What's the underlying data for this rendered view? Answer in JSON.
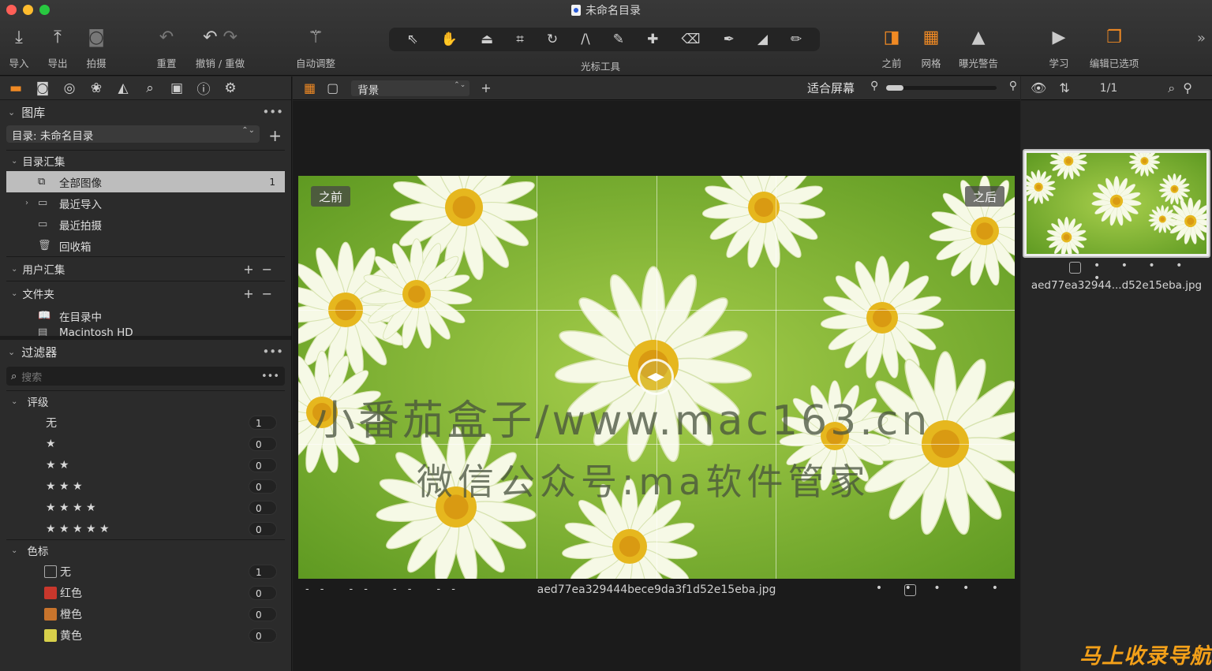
{
  "window": {
    "title": "未命名目录"
  },
  "toolbar": {
    "import": "导入",
    "export": "导出",
    "capture": "拍摄",
    "reset": "重置",
    "undo_redo": "撤销 / 重做",
    "auto_adjust": "自动调整",
    "cursor_tools": "光标工具",
    "before": "之前",
    "grid": "网格",
    "exposure_warning": "曝光警告",
    "learn": "学习",
    "edit_selected": "编辑已选项"
  },
  "library": {
    "title": "图库",
    "catalog_select": "目录: 未命名目录",
    "catalog_collections": "目录汇集",
    "items": [
      {
        "label": "全部图像",
        "count": "1"
      },
      {
        "label": "最近导入"
      },
      {
        "label": "最近拍摄"
      },
      {
        "label": "回收箱"
      }
    ],
    "user_collections": "用户汇集",
    "folders": "文件夹",
    "in_catalog": "在目录中",
    "macintosh": "Macintosh HD"
  },
  "filters": {
    "title": "过滤器",
    "search_placeholder": "搜索",
    "rating_title": "评级",
    "ratings": [
      {
        "label": "无",
        "count": "1"
      },
      {
        "label": "★",
        "count": "0"
      },
      {
        "label": "★ ★",
        "count": "0"
      },
      {
        "label": "★ ★ ★",
        "count": "0"
      },
      {
        "label": "★ ★ ★ ★",
        "count": "0"
      },
      {
        "label": "★ ★ ★ ★ ★",
        "count": "0"
      }
    ],
    "color_title": "色标",
    "colors": [
      {
        "label": "无",
        "count": "1",
        "color": "transparent"
      },
      {
        "label": "红色",
        "count": "0",
        "color": "#c9372c"
      },
      {
        "label": "橙色",
        "count": "0",
        "color": "#c8742c"
      },
      {
        "label": "黄色",
        "count": "0",
        "color": "#d8d04a"
      }
    ]
  },
  "viewer": {
    "variant": "背景",
    "fit": "适合屏幕",
    "zoom_level": 0.15,
    "before_tag": "之前",
    "after_tag": "之后",
    "watermark1": "小番茄盒子/www.mac163.cn",
    "watermark2": "微信公众号:ma软件管家",
    "footer_dashes": "-- -- -- --",
    "filename": "aed77ea329444bece9da3f1d52e15eba.jpg",
    "dots": "• • • • •"
  },
  "browser": {
    "count": "1/1",
    "thumb_filename": "aed77ea32944...d52e15eba.jpg",
    "dots": "• • • • •"
  },
  "brand": "马上收录导航",
  "colors": {
    "accent": "#f08a24"
  }
}
